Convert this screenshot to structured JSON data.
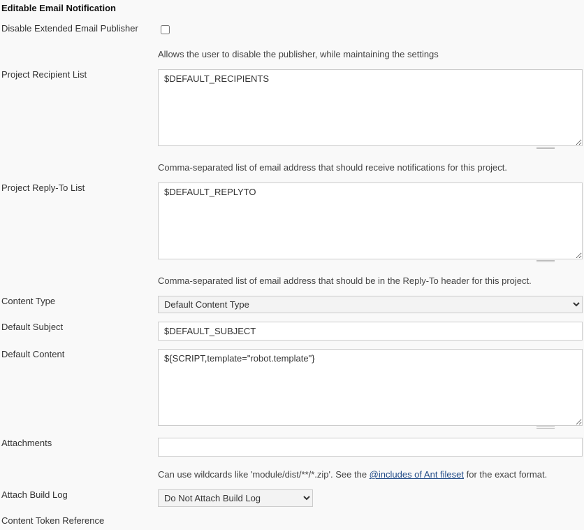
{
  "section_title": "Editable Email Notification",
  "disable_publisher": {
    "label": "Disable Extended Email Publisher",
    "checked": false,
    "help": "Allows the user to disable the publisher, while maintaining the settings"
  },
  "recipient_list": {
    "label": "Project Recipient List",
    "value": "$DEFAULT_RECIPIENTS",
    "help": "Comma-separated list of email address that should receive notifications for this project."
  },
  "replyto_list": {
    "label": "Project Reply-To List",
    "value": "$DEFAULT_REPLYTO",
    "help": "Comma-separated list of email address that should be in the Reply-To header for this project."
  },
  "content_type": {
    "label": "Content Type",
    "selected": "Default Content Type"
  },
  "default_subject": {
    "label": "Default Subject",
    "value": "$DEFAULT_SUBJECT"
  },
  "default_content": {
    "label": "Default Content",
    "value": "${SCRIPT,template=\"robot.template\"}"
  },
  "attachments": {
    "label": "Attachments",
    "value": "",
    "help_pre": "Can use wildcards like 'module/dist/**/*.zip'. See the ",
    "help_link": "@includes of Ant fileset",
    "help_post": " for the exact format."
  },
  "attach_build_log": {
    "label": "Attach Build Log",
    "selected": "Do Not Attach Build Log"
  },
  "content_token_reference": {
    "label": "Content Token Reference"
  }
}
